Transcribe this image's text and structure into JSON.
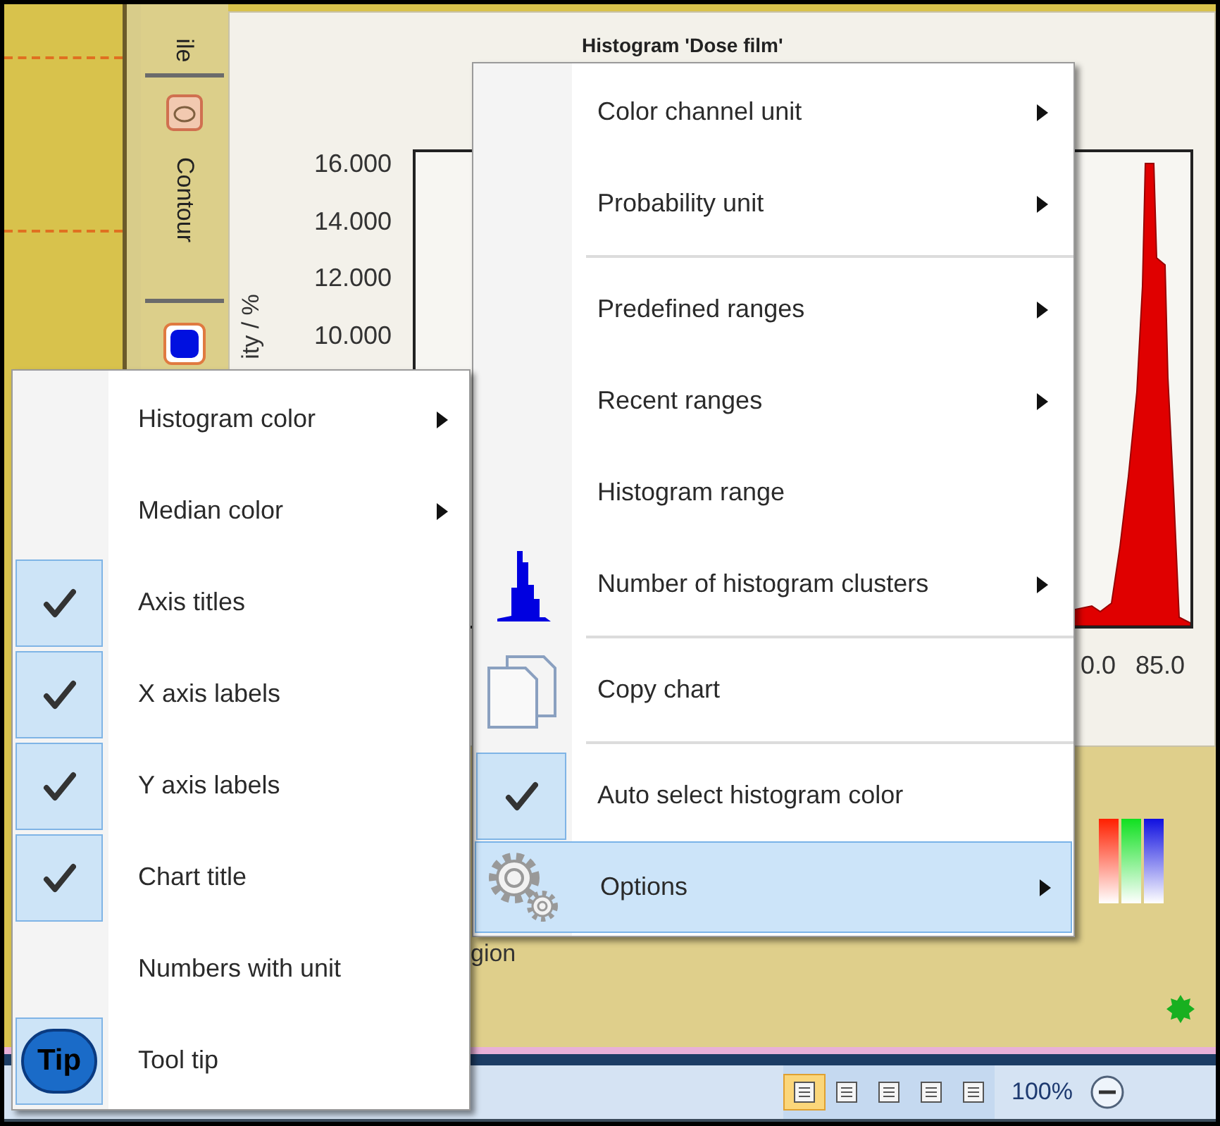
{
  "side_strip": {
    "tabs": [
      {
        "label": "ile"
      },
      {
        "label": "Contour"
      }
    ]
  },
  "chart": {
    "title": "Histogram 'Dose film'",
    "y_axis_title": "ity / %",
    "y_tick_labels": [
      "16.000",
      "14.000",
      "12.000",
      "10.000"
    ],
    "x_tick_labels": [
      "0.0",
      "85.0"
    ]
  },
  "lower_panel": {
    "text_fragment": "gion"
  },
  "status_bar": {
    "views": [
      {
        "selected": true
      },
      {
        "selected": false
      },
      {
        "selected": false
      },
      {
        "selected": false
      },
      {
        "selected": false
      }
    ],
    "zoom": "100%"
  },
  "context_menu": {
    "items": [
      {
        "label": "Color channel unit",
        "kind": "submenu",
        "checked": false,
        "selected": false,
        "separator_before": false
      },
      {
        "label": "Probability unit",
        "kind": "submenu",
        "checked": false,
        "selected": false,
        "separator_before": false
      },
      {
        "label": "Predefined ranges",
        "kind": "submenu",
        "checked": false,
        "selected": false,
        "separator_before": true
      },
      {
        "label": "Recent ranges",
        "kind": "submenu",
        "checked": false,
        "selected": false,
        "separator_before": false
      },
      {
        "label": "Histogram range",
        "kind": "action",
        "checked": false,
        "selected": false,
        "separator_before": false
      },
      {
        "label": "Number of histogram clusters",
        "kind": "submenu",
        "checked": false,
        "selected": false,
        "separator_before": false
      },
      {
        "label": "Copy chart",
        "kind": "action",
        "checked": false,
        "selected": false,
        "separator_before": true
      },
      {
        "label": "Auto select histogram color",
        "kind": "check",
        "checked": true,
        "selected": false,
        "separator_before": true
      },
      {
        "label": "Options",
        "kind": "submenu",
        "checked": false,
        "selected": true,
        "separator_before": false
      }
    ]
  },
  "options_submenu": {
    "items": [
      {
        "label": "Histogram color",
        "kind": "submenu",
        "checked": false,
        "selected": false,
        "separator_before": false
      },
      {
        "label": "Median color",
        "kind": "submenu",
        "checked": false,
        "selected": false,
        "separator_before": false
      },
      {
        "label": "Axis titles",
        "kind": "check",
        "checked": true,
        "selected": false,
        "separator_before": false
      },
      {
        "label": "X axis labels",
        "kind": "check",
        "checked": true,
        "selected": false,
        "separator_before": false
      },
      {
        "label": "Y axis labels",
        "kind": "check",
        "checked": true,
        "selected": false,
        "separator_before": false
      },
      {
        "label": "Chart title",
        "kind": "check",
        "checked": true,
        "selected": false,
        "separator_before": false
      },
      {
        "label": "Numbers with unit",
        "kind": "check",
        "checked": false,
        "selected": false,
        "separator_before": false
      },
      {
        "label": "Tool tip",
        "kind": "check",
        "icon_text": "Tip",
        "checked": true,
        "selected": false,
        "separator_before": false
      }
    ]
  }
}
